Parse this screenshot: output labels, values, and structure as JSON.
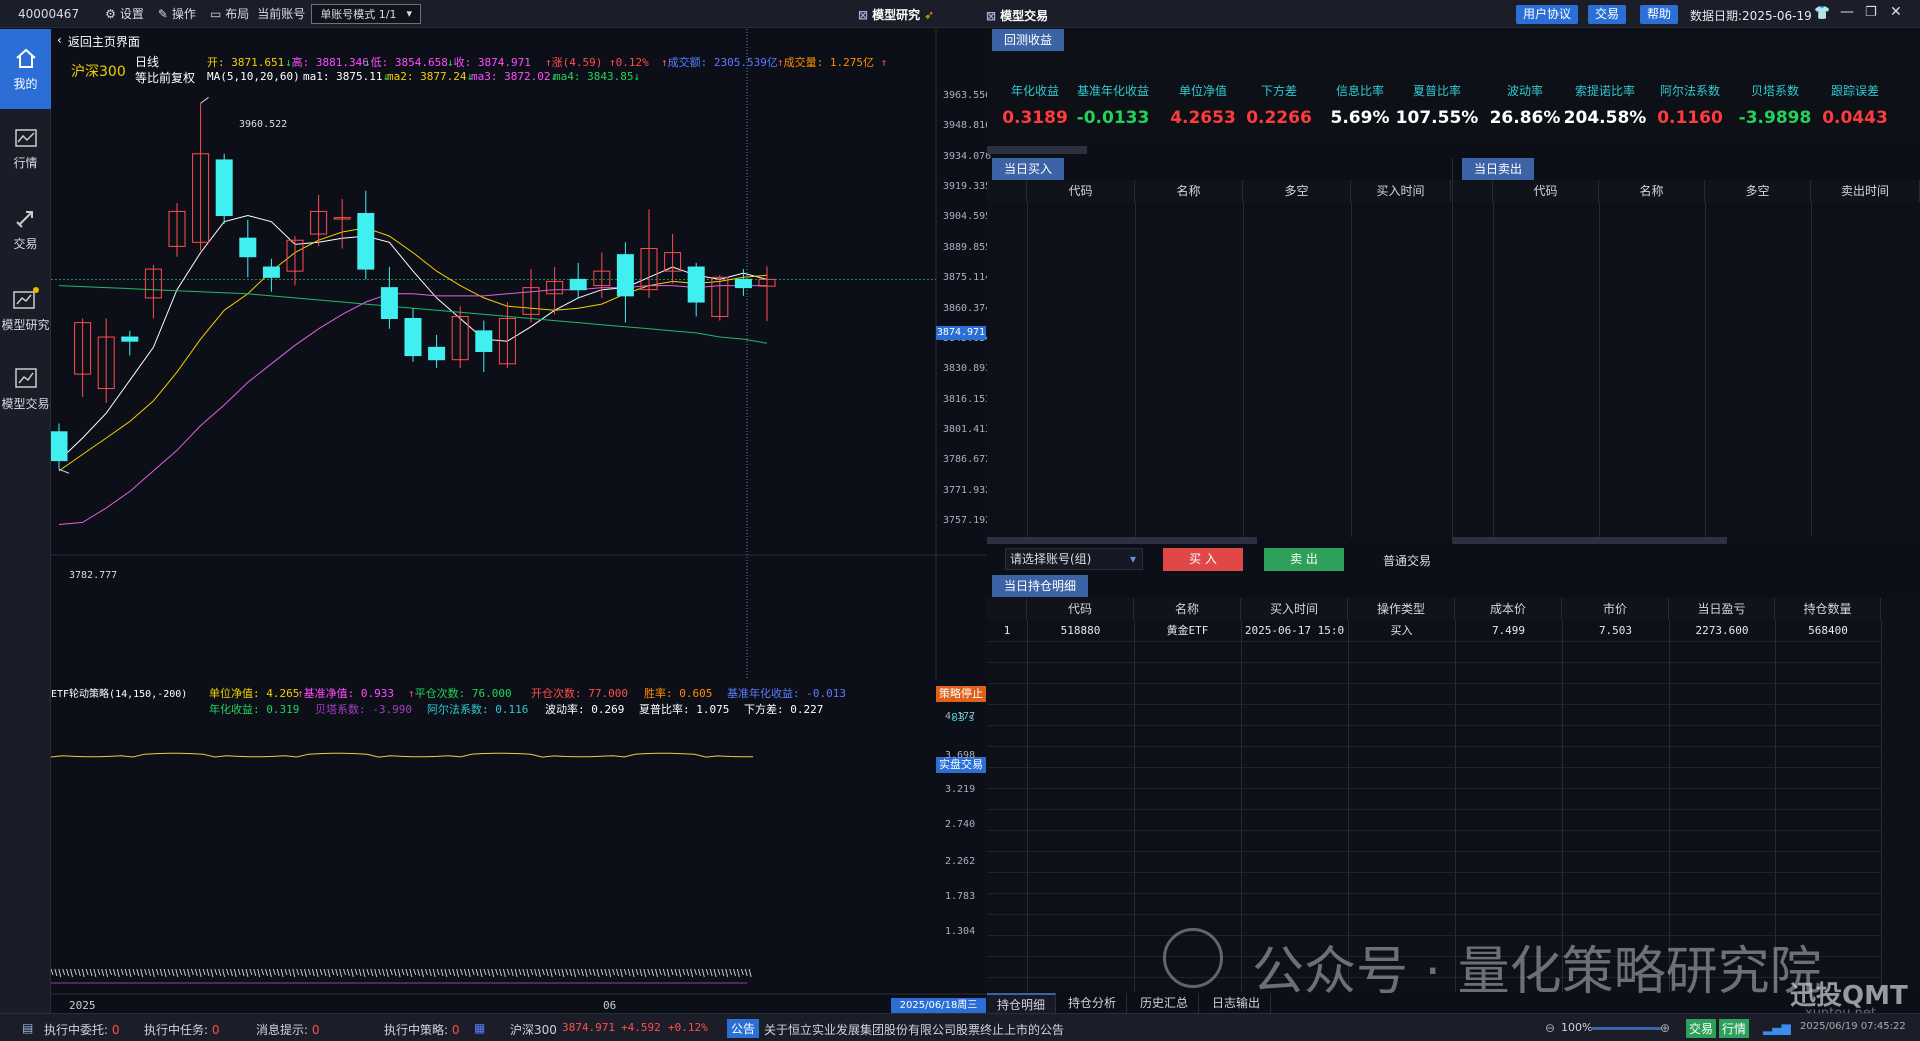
{
  "topbar": {
    "account_id": "40000467",
    "settings_label": "设置",
    "ops_label": "操作",
    "layout_label": "布局",
    "current_account_label": "当前账号",
    "account_mode": "单账号模式 1/1",
    "center_title": "模型研究",
    "right_title": "模型交易",
    "btn_user_agreement": "用户协议",
    "btn_trade": "交易",
    "btn_help": "帮助",
    "data_date": "数据日期:2025-06-19"
  },
  "sidebar": {
    "items": [
      {
        "label": "我的",
        "icon": "home-icon"
      },
      {
        "label": "行情",
        "icon": "market-chart-icon"
      },
      {
        "label": "交易",
        "icon": "trade-arrows-icon"
      },
      {
        "label": "模型研究",
        "icon": "model-research-icon"
      },
      {
        "label": "模型交易",
        "icon": "model-trade-icon"
      }
    ]
  },
  "chart": {
    "back_label": "返回主页界面",
    "symbol": "沪深300",
    "period": "日线",
    "adjust": "等比前复权",
    "quote": {
      "open": "开: 3871.651",
      "high": "高: 3881.346",
      "low": "低: 3854.658",
      "close": "收: 3874.971",
      "change": "涨(4.59)",
      "change_pct": "0.12%",
      "amount": "成交额: 2305.539亿",
      "volume": "成交量: 1.275亿"
    },
    "ma": {
      "params": "MA(5,10,20,60)",
      "ma1": "ma1: 3875.11",
      "ma2": "ma2: 3877.24",
      "ma3": "ma3: 3872.02",
      "ma4": "ma4: 3843.85"
    },
    "price_axis": [
      "3963.556",
      "3948.816",
      "3934.076",
      "3919.335",
      "3904.595",
      "3889.855",
      "3875.114",
      "3860.374",
      "3845.634",
      "3830.893",
      "3816.153",
      "3801.413",
      "3786.672",
      "3771.932",
      "3757.192"
    ],
    "current_price_tag": "3874.971",
    "high_label": "3960.522",
    "low_label": "3782.777",
    "x_labels": [
      "2025",
      "06"
    ],
    "date_tag": "2025/06/18周三",
    "candles": [
      {
        "o": 3801,
        "c": 3787,
        "h": 3805,
        "l": 3782.8
      },
      {
        "o": 3829,
        "c": 3854,
        "h": 3856,
        "l": 3818
      },
      {
        "o": 3822,
        "c": 3847,
        "h": 3856,
        "l": 3815
      },
      {
        "o": 3847,
        "c": 3845,
        "h": 3850,
        "l": 3838
      },
      {
        "o": 3866,
        "c": 3880,
        "h": 3882,
        "l": 3856
      },
      {
        "o": 3891,
        "c": 3908,
        "h": 3912,
        "l": 3886
      },
      {
        "o": 3893,
        "c": 3936,
        "h": 3960.5,
        "l": 3889
      },
      {
        "o": 3933,
        "c": 3906,
        "h": 3936,
        "l": 3902
      },
      {
        "o": 3895,
        "c": 3886,
        "h": 3904,
        "l": 3876
      },
      {
        "o": 3881,
        "c": 3876,
        "h": 3885,
        "l": 3869
      },
      {
        "o": 3879,
        "c": 3894,
        "h": 3896,
        "l": 3872
      },
      {
        "o": 3897,
        "c": 3908,
        "h": 3916,
        "l": 3891
      },
      {
        "o": 3905,
        "c": 3905,
        "h": 3914,
        "l": 3890
      },
      {
        "o": 3907,
        "c": 3880,
        "h": 3918,
        "l": 3875
      },
      {
        "o": 3871,
        "c": 3856,
        "h": 3881,
        "l": 3851
      },
      {
        "o": 3856,
        "c": 3838,
        "h": 3861,
        "l": 3835
      },
      {
        "o": 3842,
        "c": 3836,
        "h": 3848,
        "l": 3832
      },
      {
        "o": 3836,
        "c": 3857,
        "h": 3862,
        "l": 3832
      },
      {
        "o": 3850,
        "c": 3840,
        "h": 3855,
        "l": 3830
      },
      {
        "o": 3834,
        "c": 3856,
        "h": 3864,
        "l": 3832
      },
      {
        "o": 3858,
        "c": 3871,
        "h": 3880,
        "l": 3854
      },
      {
        "o": 3868,
        "c": 3874,
        "h": 3881,
        "l": 3858
      },
      {
        "o": 3875,
        "c": 3870,
        "h": 3883,
        "l": 3866
      },
      {
        "o": 3872,
        "c": 3879,
        "h": 3888,
        "l": 3866
      },
      {
        "o": 3887,
        "c": 3867,
        "h": 3893,
        "l": 3854
      },
      {
        "o": 3870,
        "c": 3890,
        "h": 3909,
        "l": 3866
      },
      {
        "o": 3879,
        "c": 3888,
        "h": 3897,
        "l": 3873
      },
      {
        "o": 3881,
        "c": 3864,
        "h": 3883,
        "l": 3857
      },
      {
        "o": 3857,
        "c": 3876,
        "h": 3877,
        "l": 3855
      },
      {
        "o": 3875,
        "c": 3871,
        "h": 3880,
        "l": 3867
      },
      {
        "o": 3871.7,
        "c": 3875,
        "h": 3881.3,
        "l": 3854.7
      }
    ],
    "ma_lines": {
      "ma5": [
        3787,
        3798,
        3810,
        3826,
        3842,
        3870,
        3888,
        3903,
        3906,
        3903,
        3892,
        3893,
        3895,
        3896,
        3893,
        3879,
        3866,
        3856,
        3846,
        3845,
        3852,
        3860,
        3866,
        3870,
        3871,
        3876,
        3881,
        3877,
        3875,
        3878,
        3875
      ],
      "ma10": [
        3782,
        3790,
        3798,
        3806,
        3816,
        3830,
        3846,
        3860,
        3868,
        3879,
        3888,
        3894,
        3898,
        3900,
        3896,
        3888,
        3879,
        3872,
        3866,
        3862,
        3861,
        3860,
        3861,
        3863,
        3868,
        3872,
        3874,
        3873,
        3874,
        3876,
        3877
      ],
      "ma20": [
        3756,
        3757,
        3764,
        3772,
        3782,
        3792,
        3804,
        3814,
        3825,
        3834,
        3843,
        3851,
        3858,
        3864,
        3868,
        3868,
        3867,
        3867,
        3867,
        3868,
        3869,
        3870,
        3870,
        3871,
        3871,
        3872,
        3872,
        3871,
        3872,
        3872,
        3872
      ],
      "ma60": [
        3872,
        3871.5,
        3871,
        3870.5,
        3870,
        3869.5,
        3869,
        3868.5,
        3868,
        3867,
        3866,
        3865,
        3864,
        3863,
        3862,
        3861,
        3860,
        3859,
        3858,
        3857,
        3856,
        3855,
        3854,
        3853,
        3852,
        3851,
        3850,
        3849,
        3847,
        3846,
        3844
      ]
    }
  },
  "indicator": {
    "name": "ETF轮动策略(14,150,-200)",
    "unit_nav": "单位净值: 4.265",
    "bench_nav": "基准净值: 0.933",
    "close_count": "平仓次数: 76.000",
    "open_count": "开仓次数: 77.000",
    "win_rate": "胜率: 0.605",
    "bench_annual": "基准年化收益: -0.013",
    "annual": "年化收益: 0.319",
    "beta": "贝塔系数: -3.990",
    "alpha": "阿尔法系数: 0.116",
    "volatility": "波动率: 0.269",
    "sharpe": "夏普比率: 1.075",
    "downside": "下方差: 0.227",
    "stop_btn": "策略停止",
    "timer": "83 s",
    "live_btn": "实盘交易",
    "axis": [
      "4.177",
      "3.698",
      "3.219",
      "2.740",
      "2.262",
      "1.783",
      "1.304"
    ]
  },
  "backtest": {
    "header": "回测收益",
    "metrics": [
      {
        "label": "年化收益",
        "value": "0.3189",
        "color": "#ff3b3b"
      },
      {
        "label": "基准年化收益",
        "value": "-0.0133",
        "color": "#22d35a"
      },
      {
        "label": "单位净值",
        "value": "4.2653",
        "color": "#ff3b3b"
      },
      {
        "label": "下方差",
        "value": "0.2266",
        "color": "#ff3b3b"
      },
      {
        "label": "信息比率",
        "value": "5.69%",
        "color": "#ffffff"
      },
      {
        "label": "夏普比率",
        "value": "107.55%",
        "color": "#ffffff"
      },
      {
        "label": "波动率",
        "value": "26.86%",
        "color": "#ffffff"
      },
      {
        "label": "索提诺比率",
        "value": "204.58%",
        "color": "#ffffff"
      },
      {
        "label": "阿尔法系数",
        "value": "0.1160",
        "color": "#ff3b3b"
      },
      {
        "label": "贝塔系数",
        "value": "-3.9898",
        "color": "#22d35a"
      },
      {
        "label": "跟踪误差",
        "value": "0.0443",
        "color": "#ff3b3b"
      }
    ]
  },
  "buy_today": {
    "header": "当日买入",
    "columns": [
      "代码",
      "名称",
      "多空",
      "买入时间"
    ]
  },
  "sell_today": {
    "header": "当日卖出",
    "columns": [
      "代码",
      "名称",
      "多空",
      "卖出时间"
    ]
  },
  "order": {
    "account_placeholder": "请选择账号(组)",
    "buy": "买 入",
    "sell": "卖 出",
    "normal_trade": "普通交易"
  },
  "positions": {
    "header": "当日持仓明细",
    "columns": [
      "代码",
      "名称",
      "买入时间",
      "操作类型",
      "成本价",
      "市价",
      "当日盈亏",
      "持仓数量"
    ],
    "rows": [
      {
        "idx": "1",
        "cells": [
          "518880",
          "黄金ETF",
          "2025-06-17 15:0",
          "买入",
          "7.499",
          "7.503",
          "2273.600",
          "568400"
        ]
      }
    ]
  },
  "bottom_tabs": [
    "持仓明细",
    "持仓分析",
    "历史汇总",
    "日志输出"
  ],
  "status": {
    "pending_orders": "执行中委托:",
    "pending_orders_n": "0",
    "pending_tasks": "执行中任务:",
    "pending_tasks_n": "0",
    "messages": "消息提示:",
    "messages_n": "0",
    "strategies": "执行中策略:",
    "strategies_n": "0",
    "index_name": "沪深300",
    "index_price": "3874.971",
    "index_chg": "+4.592",
    "index_pct": "+0.12%",
    "notice_tag": "公告",
    "notice": "关于恒立实业发展集团股份有限公司股票终止上市的公告",
    "zoom": "100%",
    "tag_trade": "交易",
    "tag_market": "行情",
    "datetime": "2025/06/19 07:45:22"
  },
  "watermark": {
    "text": "公众号 · 量化策略研究院",
    "brand": "迅投QMT",
    "url": "xuntou.net"
  }
}
